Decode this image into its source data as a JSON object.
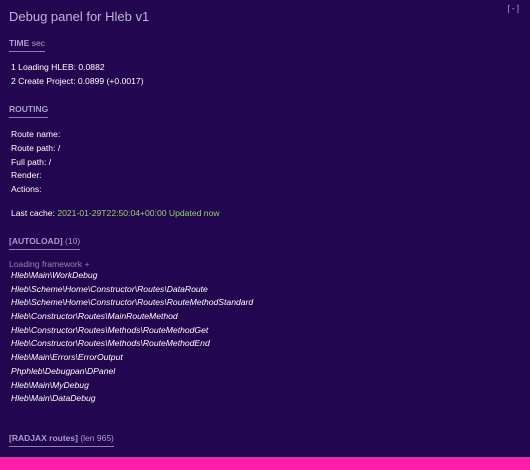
{
  "panel": {
    "title": "Debug panel for Hleb v1",
    "toggle": "[ - ]"
  },
  "time": {
    "heading": "TIME",
    "heading_suffix": "sec",
    "entries": [
      "1 Loading HLEB: 0.0882",
      "2 Create Project: 0.0899 (+0.0017)"
    ]
  },
  "routing": {
    "heading": "ROUTING",
    "route_name": "Route name:",
    "route_path": "Route path: /",
    "full_path": "Full path: /",
    "render": "Render:",
    "actions": "Actions:",
    "last_cache_label": "Last cache:",
    "last_cache_value": "2021-01-29T22:50:04+00:00 Updated now"
  },
  "autoload": {
    "heading": "[AUTOLOAD]",
    "count": "(10)",
    "loading": "Loading framework +",
    "classes": [
      "Hleb\\Main\\WorkDebug",
      "Hleb\\Scheme\\Home\\Constructor\\Routes\\DataRoute",
      "Hleb\\Scheme\\Home\\Constructor\\Routes\\RouteMethodStandard",
      "Hleb\\Constructor\\Routes\\MainRouteMethod",
      "Hleb\\Constructor\\Routes\\Methods\\RouteMethodGet",
      "Hleb\\Constructor\\Routes\\Methods\\RouteMethodEnd",
      "Hleb\\Main\\Errors\\ErrorOutput",
      "Phphleb\\Debugpan\\DPanel",
      "Hleb\\Main\\MyDebug",
      "Hleb\\Main\\DataDebug"
    ]
  },
  "radjax": {
    "heading": "[RADJAX routes]",
    "len": "(len 965)"
  },
  "colors": {
    "background": "#22064f",
    "bottom_bar": "#ff1fa8",
    "cache_value": "#9bd16b"
  }
}
